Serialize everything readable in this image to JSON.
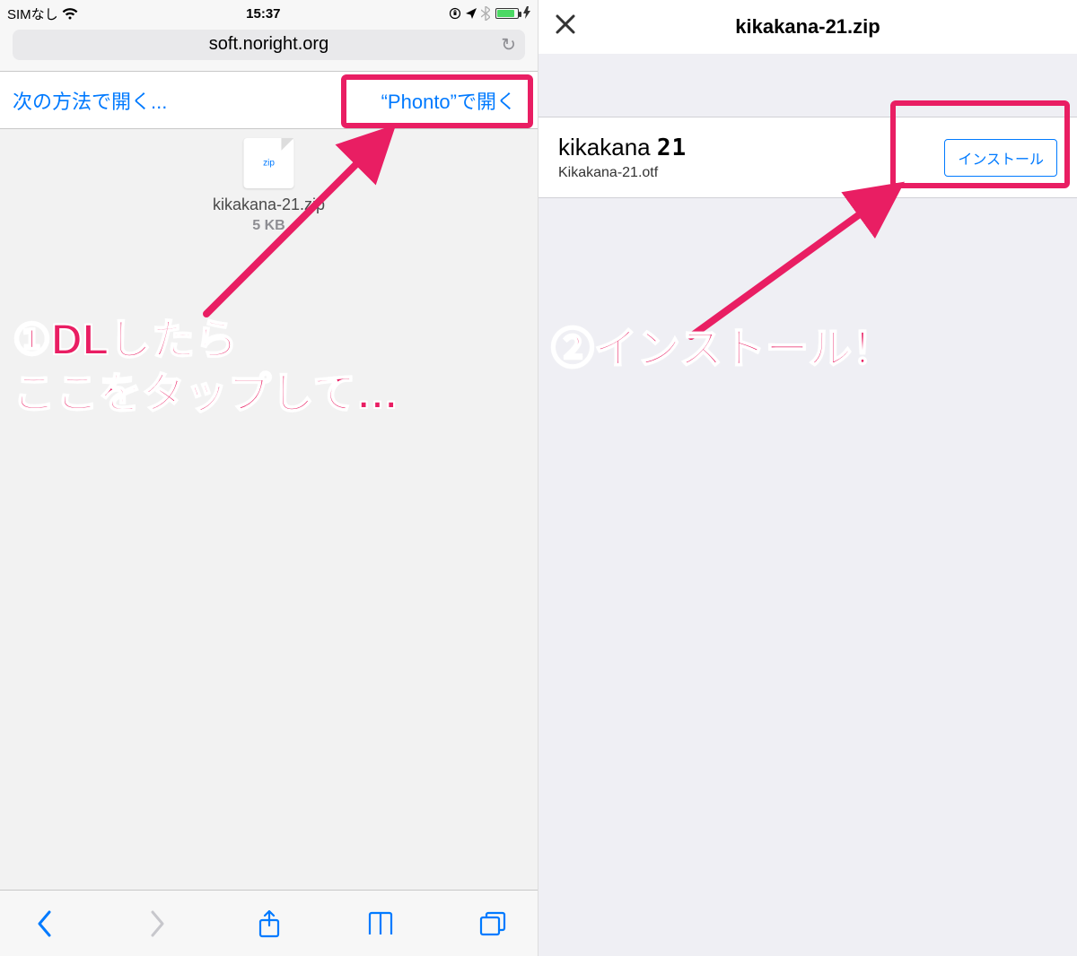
{
  "left": {
    "status": {
      "carrier": "SIMなし",
      "time": "15:37"
    },
    "url": "soft.noright.org",
    "open_bar": {
      "open_with": "次の方法で開く...",
      "open_in_phonto": "“Phonto”で開く"
    },
    "file": {
      "ext_label": "zip",
      "name": "kikakana-21.zip",
      "size": "5 KB"
    }
  },
  "right": {
    "title": "kikakana-21.zip",
    "font_row": {
      "display_name": "kikakana ",
      "display_num": "21",
      "filename": "Kikakana-21.otf",
      "install_label": "インストール"
    }
  },
  "annotations": {
    "left_text": "①DLしたら\nここをタップして…",
    "right_text": "②インストール！"
  },
  "colors": {
    "accent_pink": "#e91e63",
    "ios_blue": "#007aff"
  }
}
